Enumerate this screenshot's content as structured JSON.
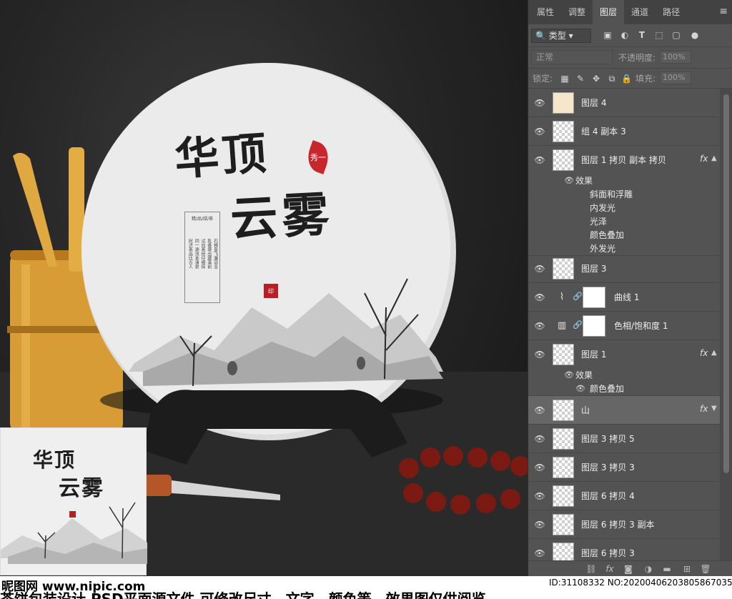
{
  "artwork": {
    "title_line1": "华顶",
    "title_line2": "云雾",
    "leaf_seal": "秀一",
    "box_header": "精/品/绿/茶",
    "box_columns": [
      "石梯皆飞瀑冠全",
      "乳香堪出建溪前",
      "试向茶经仔细探",
      "同一源流本清泉",
      "阿济茶品比古人"
    ],
    "red_stamp": "印"
  },
  "thumbnail": {
    "title_line1": "华顶",
    "title_line2": "云雾"
  },
  "watermark": {
    "logo": "昵图网 www.nipic.com",
    "id": "ID:31108332 NO:20200406203805867035",
    "caption": "茶饼包装设计 PSD平面源文件 可修改尺寸、文字、颜色等，效果图仅供阅览"
  },
  "panel": {
    "tabs": [
      {
        "label": "属性",
        "active": false
      },
      {
        "label": "调整",
        "active": false
      },
      {
        "label": "图层",
        "active": true
      },
      {
        "label": "通道",
        "active": false
      },
      {
        "label": "路径",
        "active": false
      }
    ],
    "menu_icon": "≡",
    "filter": {
      "kind_label": "类型",
      "icons": [
        "image-filter-icon",
        "adjustment-filter-icon",
        "type-filter-icon",
        "shape-filter-icon",
        "smart-object-filter-icon",
        "filter-toggle-icon"
      ]
    },
    "blend_mode": "正常",
    "opacity_label": "不透明度:",
    "opacity_value": "100%",
    "lock_label": "锁定:",
    "fill_label": "填充:",
    "fill_value": "100%",
    "layers": [
      {
        "name": "图层 4",
        "type": "pixel",
        "fx": false
      },
      {
        "name": "组 4 副本 3",
        "type": "pixel",
        "fx": false
      },
      {
        "name": "图层 1 拷贝 副本 拷贝",
        "type": "pixel",
        "fx": true,
        "expanded": true
      },
      {
        "name": "图层 3",
        "type": "pixel",
        "fx": false
      },
      {
        "name": "曲线 1",
        "type": "adjustment",
        "icon": "curves-icon"
      },
      {
        "name": "色相/饱和度 1",
        "type": "adjustment",
        "icon": "hue-saturation-icon"
      },
      {
        "name": "图层 1",
        "type": "pixel",
        "fx": true,
        "expanded": true
      },
      {
        "name": "山",
        "type": "pixel",
        "fx": true,
        "selected": true
      },
      {
        "name": "图层 3 拷贝 5",
        "type": "pixel",
        "fx": false
      },
      {
        "name": "图层 3 拷贝 3",
        "type": "pixel",
        "fx": false
      },
      {
        "name": "图层 6 拷贝 4",
        "type": "pixel",
        "fx": false
      },
      {
        "name": "图层 6 拷贝 3 副本",
        "type": "pixel",
        "fx": false
      },
      {
        "name": "图层 6 拷贝 3",
        "type": "pixel",
        "fx": false
      }
    ],
    "effects_a": {
      "header": "效果",
      "items": [
        "斜面和浮雕",
        "内发光",
        "光泽",
        "颜色叠加",
        "外发光"
      ]
    },
    "effects_b": {
      "header": "效果",
      "items": [
        "颜色叠加"
      ]
    },
    "fx_label": "fx",
    "footer_icons": [
      "link-layers-icon",
      "add-style-icon",
      "add-mask-icon",
      "new-adjustment-icon",
      "new-group-icon",
      "new-layer-icon",
      "delete-icon"
    ]
  }
}
